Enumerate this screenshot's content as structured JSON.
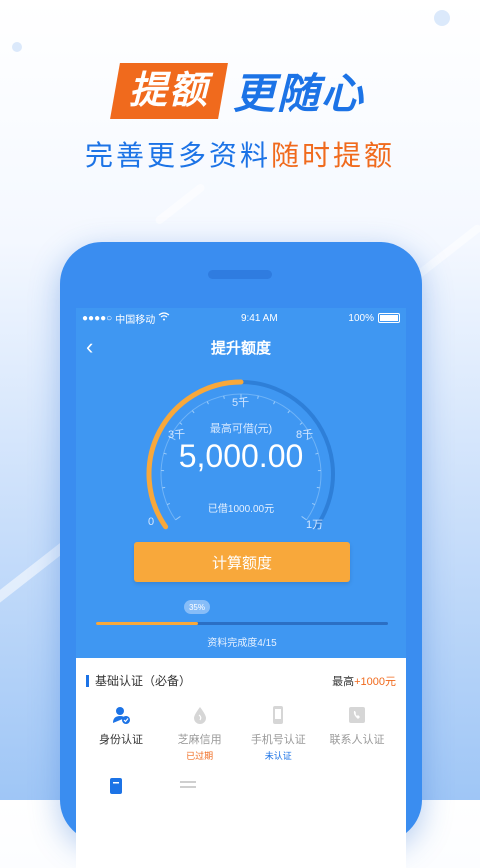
{
  "headline": {
    "tag": "提额",
    "text": "更随心"
  },
  "subline": {
    "blue": "完善更多资料",
    "orange": "随时提额"
  },
  "statusbar": {
    "signal": "●●●●○",
    "carrier": "中国移动",
    "time": "9:41 AM",
    "battery": "100%"
  },
  "nav": {
    "back_icon": "‹",
    "title": "提升额度"
  },
  "gauge": {
    "tick_labels": {
      "zero": "0",
      "three_k": "3千",
      "five_k": "5千",
      "eight_k": "8千",
      "ten_k": "1万"
    },
    "max_label": "最高可借(元)",
    "amount": "5,000.00",
    "borrowed": "已借1000.00元",
    "fill_fraction": 0.5
  },
  "calc_button": "计算额度",
  "progress": {
    "percent_label": "35%",
    "fraction": 0.35,
    "text": "资料完成度4/15"
  },
  "card": {
    "title": "基础认证（必备）",
    "max_prefix": "最高",
    "max_plus": "+1000元",
    "items": [
      {
        "label": "身份认证",
        "status": "",
        "icon": "id-user-icon"
      },
      {
        "label": "芝麻信用",
        "status": "已过期",
        "icon": "sesame-drop-icon"
      },
      {
        "label": "手机号认证",
        "status": "未认证",
        "icon": "phone-icon"
      },
      {
        "label": "联系人认证",
        "status": "",
        "icon": "contacts-icon"
      }
    ]
  },
  "colors": {
    "brand_blue": "#1c73e6",
    "brand_orange": "#f06a1d",
    "gauge_orange": "#f8a83b",
    "screen_blue": "#3f97f2"
  }
}
